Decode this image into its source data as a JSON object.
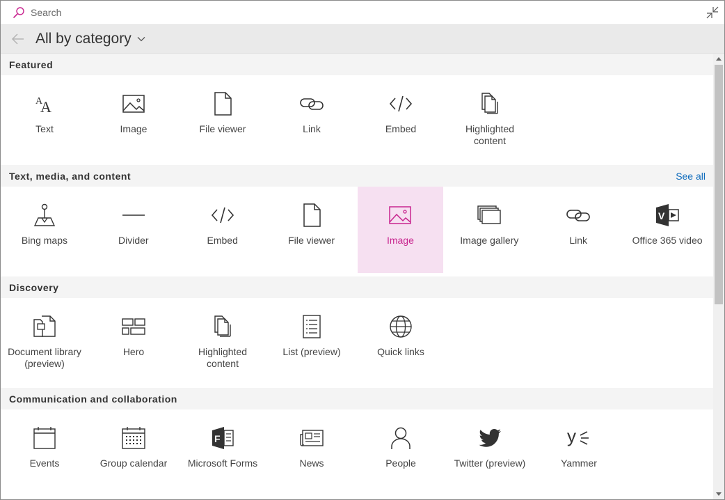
{
  "search": {
    "placeholder": "Search"
  },
  "header": {
    "title": "All by category"
  },
  "sections": [
    {
      "title": "Featured",
      "see_all": "",
      "items": [
        {
          "label": "Text",
          "icon": "text-icon"
        },
        {
          "label": "Image",
          "icon": "image-icon"
        },
        {
          "label": "File viewer",
          "icon": "file-icon"
        },
        {
          "label": "Link",
          "icon": "link-icon"
        },
        {
          "label": "Embed",
          "icon": "embed-icon"
        },
        {
          "label": "Highlighted content",
          "icon": "highlighted-content-icon"
        }
      ]
    },
    {
      "title": "Text, media, and content",
      "see_all": "See all",
      "items": [
        {
          "label": "Bing maps",
          "icon": "map-pin-icon"
        },
        {
          "label": "Divider",
          "icon": "divider-icon"
        },
        {
          "label": "Embed",
          "icon": "embed-icon"
        },
        {
          "label": "File viewer",
          "icon": "file-icon"
        },
        {
          "label": "Image",
          "icon": "image-icon",
          "selected": true
        },
        {
          "label": "Image gallery",
          "icon": "image-gallery-icon"
        },
        {
          "label": "Link",
          "icon": "link-icon"
        },
        {
          "label": "Office 365 video",
          "icon": "office-video-icon"
        }
      ]
    },
    {
      "title": "Discovery",
      "see_all": "",
      "items": [
        {
          "label": "Document library (preview)",
          "icon": "document-library-icon"
        },
        {
          "label": "Hero",
          "icon": "hero-icon"
        },
        {
          "label": "Highlighted content",
          "icon": "highlighted-content-icon"
        },
        {
          "label": "List (preview)",
          "icon": "list-icon"
        },
        {
          "label": "Quick links",
          "icon": "globe-icon"
        }
      ]
    },
    {
      "title": "Communication and collaboration",
      "see_all": "",
      "items": [
        {
          "label": "Events",
          "icon": "events-icon"
        },
        {
          "label": "Group calendar",
          "icon": "calendar-icon"
        },
        {
          "label": "Microsoft Forms",
          "icon": "forms-icon"
        },
        {
          "label": "News",
          "icon": "news-icon"
        },
        {
          "label": "People",
          "icon": "people-icon"
        },
        {
          "label": "Twitter (preview)",
          "icon": "twitter-icon"
        },
        {
          "label": "Yammer",
          "icon": "yammer-icon"
        }
      ]
    }
  ],
  "colors": {
    "accent": "#c8258f",
    "selected_bg": "#f6e0f1",
    "link": "#0f6cbd"
  }
}
